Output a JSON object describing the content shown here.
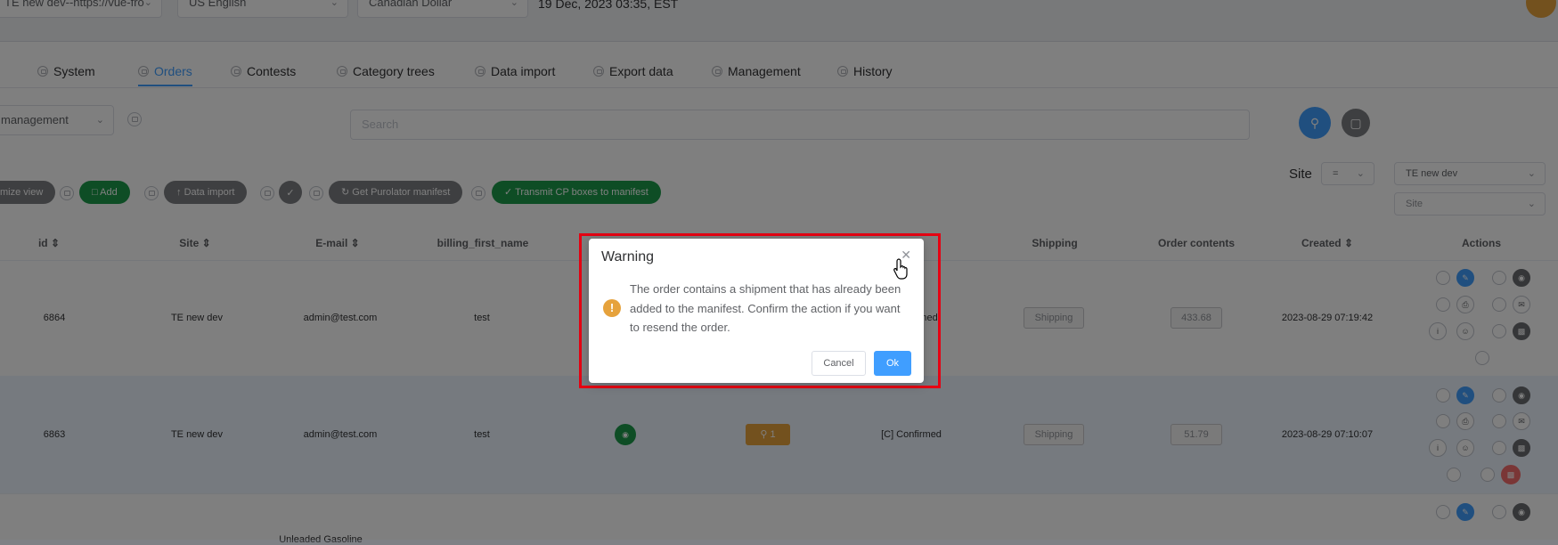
{
  "topbar": {
    "env_select": "TE new dev--https://vue-fro",
    "language_select": "US English",
    "currency_select": "Canadian Dollar",
    "datetime": "19 Dec, 2023 03:35, EST"
  },
  "tabs": [
    {
      "label": "System"
    },
    {
      "label": "Orders",
      "active": true
    },
    {
      "label": "Contests"
    },
    {
      "label": "Category trees"
    },
    {
      "label": "Data import"
    },
    {
      "label": "Export data"
    },
    {
      "label": "Management"
    },
    {
      "label": "History"
    }
  ],
  "filters": {
    "view_select": "management",
    "search_placeholder": "Search"
  },
  "toolbar": {
    "customize_view": "mize view",
    "add": "Add",
    "data_import": "Data import",
    "get_purolator": "Get Purolator manifest",
    "transmit_cp": "Transmit CP boxes to manifest",
    "site_label": "Site",
    "site_operator": "=",
    "site_value": "TE new dev",
    "site_placeholder": "Site"
  },
  "table": {
    "headers": {
      "id": "id",
      "site": "Site",
      "email": "E-mail",
      "billing_first_name": "billing_first_name",
      "shipping": "Shipping",
      "order_contents": "Order contents",
      "created": "Created",
      "actions": "Actions"
    },
    "rows": [
      {
        "id": "6864",
        "site": "TE new dev",
        "email": "admin@test.com",
        "first_name": "test",
        "status": "[C] Confirmed",
        "status_visible": "med",
        "shipping": "Shipping",
        "contents": "433.68",
        "created": "2023-08-29 07:19:42"
      },
      {
        "id": "6863",
        "site": "TE new dev",
        "email": "admin@test.com",
        "first_name": "test",
        "badge": "1",
        "status": "[C] Confirmed",
        "shipping": "Shipping",
        "contents": "51.79",
        "created": "2023-08-29 07:10:07"
      }
    ],
    "partial_row_text": "Unleaded Gasoline"
  },
  "dialog": {
    "title": "Warning",
    "message": "The order contains a shipment that has already been added to the manifest. Confirm the action if you want to resend the order.",
    "cancel": "Cancel",
    "ok": "Ok"
  },
  "colors": {
    "primary": "#409eff",
    "success": "#1d9b4b",
    "warning": "#e6a23c",
    "danger": "#f56c6c",
    "highlight": "#e60012"
  }
}
